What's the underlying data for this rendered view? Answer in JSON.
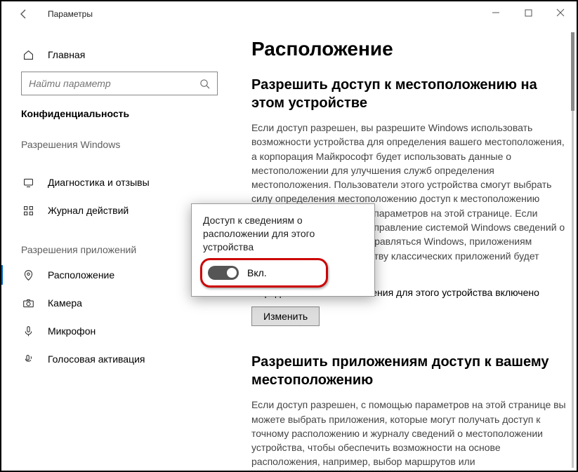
{
  "window": {
    "title": "Параметры"
  },
  "sidebar": {
    "home": "Главная",
    "search_placeholder": "Найти параметр",
    "category": "Конфиденциальность",
    "section_windows": "Разрешения Windows",
    "section_apps": "Разрешения приложений",
    "items_windows": [
      {
        "label": "Диагностика и отзывы"
      },
      {
        "label": "Журнал действий"
      }
    ],
    "items_apps": [
      {
        "label": "Расположение"
      },
      {
        "label": "Камера"
      },
      {
        "label": "Микрофон"
      },
      {
        "label": "Голосовая активация"
      }
    ]
  },
  "main": {
    "h1": "Расположение",
    "h2a": "Разрешить доступ к местоположению на этом устройстве",
    "p1": "Если доступ разрешен, вы разрешите Windows использовать возможности устройства для определения вашего местоположения, а корпорация Майкрософт будет использовать данные о местоположении для улучшения служб определения местоположения. Пользователи этого устройства смогут выбрать силу определения местоположению доступ к местоположению останется установленным параметров на этой странице. Если доступ запрещён, только управление системой Windows сведений о местоположении будут отправляться Windows, приложениям Microsoft Store и большинству классических приложений будет заблокирован.",
    "status": "Определение местоположения для этого устройства включено",
    "change_btn": "Изменить",
    "h2b": "Разрешить приложениям доступ к вашему местоположению",
    "p2": "Если доступ разрешен, с помощью параметров на этой странице вы можете выбрать приложения, которые могут получать доступ к точному расположению и журналу сведений о местоположении устройства, чтобы обеспечить возможности на основе расположения, например, выбор маршрутов или"
  },
  "popup": {
    "title": "Доступ к сведениям о расположении для этого устройства",
    "toggle_label": "Вкл."
  }
}
